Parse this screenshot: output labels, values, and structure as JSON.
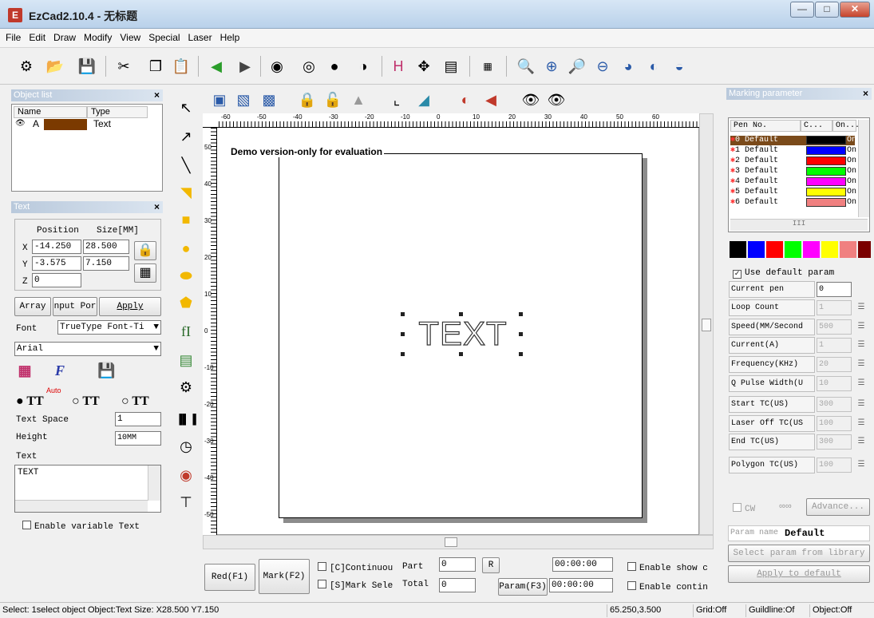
{
  "window": {
    "title": "EzCad2.10.4 - 无标题",
    "logo_text": "E"
  },
  "menu": [
    "File",
    "Edit",
    "Draw",
    "Modify",
    "View",
    "Special",
    "Laser",
    "Help"
  ],
  "toolbar_icons": [
    "gear-icon",
    "folder-open-icon",
    "save-icon",
    "cut-icon",
    "copy-icon",
    "paste-icon",
    "back-icon",
    "forward-icon",
    "node-select-icon",
    "node-add-icon",
    "node-delete-icon",
    "node-break-icon",
    "hatch-icon",
    "tools-icon",
    "properties-icon",
    "pen-table-icon",
    "zoom-icon",
    "zoom-in-icon",
    "zoom-plus-icon",
    "zoom-out-icon",
    "zoom-fit-icon",
    "zoom-all-icon",
    "zoom-objects-icon"
  ],
  "object_list": {
    "title": "Object list",
    "headers": [
      "Name",
      "Type"
    ],
    "rows": [
      {
        "name": "A",
        "type": "Text",
        "color": "#7b3a00"
      }
    ]
  },
  "text_panel": {
    "title": "Text",
    "position_label": "Position",
    "size_label": "Size[MM]",
    "x_label": "X",
    "x": "-14.250",
    "w": "28.500",
    "y_label": "Y",
    "y": "-3.575",
    "h": "7.150",
    "z_label": "Z",
    "z": "0",
    "array_btn": "Array",
    "input_btn": "nput Por",
    "apply_btn": "Apply",
    "font_label": "Font",
    "font_type": "TrueType Font-Ti",
    "font_name": "Arial",
    "auto_label": "Auto",
    "text_space_label": "Text Space",
    "text_space": "1",
    "height_label": "Height",
    "height": "10MM",
    "text_label": "Text",
    "text_value": "TEXT",
    "variable_label": "Enable variable Text"
  },
  "canvas": {
    "demo_label": "Demo version-only for evaluation",
    "text_object": "TEXT",
    "hruler_labels": [
      "-60",
      "-50",
      "-40",
      "-30",
      "-20",
      "-10",
      "0",
      "10",
      "20",
      "30",
      "40",
      "50",
      "60"
    ],
    "vruler_labels": [
      "50",
      "40",
      "30",
      "20",
      "10",
      "0",
      "-10",
      "-20",
      "-30",
      "-40",
      "-50"
    ]
  },
  "marking": {
    "title": "Marking parameter",
    "headers": [
      "Pen No.",
      "C...",
      "On..."
    ],
    "pens": [
      {
        "label": "0 Default",
        "color": "#000000",
        "on": "On"
      },
      {
        "label": "1 Default",
        "color": "#0000ff",
        "on": "On"
      },
      {
        "label": "2 Default",
        "color": "#ff0000",
        "on": "On"
      },
      {
        "label": "3 Default",
        "color": "#00ff00",
        "on": "On"
      },
      {
        "label": "4 Default",
        "color": "#ff00ff",
        "on": "On"
      },
      {
        "label": "5 Default",
        "color": "#ffff00",
        "on": "On"
      },
      {
        "label": "6 Default",
        "color": "#f08080",
        "on": "On"
      }
    ],
    "scroll_label": "III",
    "palette": [
      "#000000",
      "#0000ff",
      "#ff0000",
      "#00ff00",
      "#ff00ff",
      "#ffff00",
      "#f08080",
      "#7a0000"
    ],
    "use_default": "Use default param",
    "current_pen_label": "Current pen",
    "current_pen": "0",
    "params": [
      {
        "label": "Loop Count",
        "value": "1"
      },
      {
        "label": "Speed(MM/Second",
        "value": "500"
      },
      {
        "label": "Current(A)",
        "value": "1"
      },
      {
        "label": "Frequency(KHz)",
        "value": "20"
      },
      {
        "label": "Q Pulse Width(U",
        "value": "10"
      },
      {
        "label": "Start TC(US)",
        "value": "300"
      },
      {
        "label": "Laser Off TC(US",
        "value": "100"
      },
      {
        "label": "End TC(US)",
        "value": "300"
      },
      {
        "label": "Polygon TC(US)",
        "value": "100"
      }
    ],
    "cw_label": "CW",
    "advance_btn": "Advance...",
    "param_name_label": "Param name",
    "param_name": "Default",
    "select_library_btn": "Select param from library",
    "apply_default_btn": "Apply to default"
  },
  "bottom": {
    "red_btn": "Red(F1)",
    "mark_btn": "Mark(F2)",
    "continuous_label": "[C]Continuou",
    "mark_select_label": "[S]Mark Sele",
    "part_label": "Part",
    "part_value": "0",
    "total_label": "Total",
    "total_value": "0",
    "r_btn": "R",
    "param_btn": "Param(F3)",
    "time1": "00:00:00",
    "time2": "00:00:00",
    "enable_show": "Enable show c",
    "enable_contin": "Enable contin"
  },
  "status": {
    "message": "Select: 1select object Object:Text Size: X28.500 Y7.150",
    "coords": "65.250,3.500",
    "grid": "Grid:Off",
    "guideline": "Guildline:Of",
    "object": "Object:Off"
  }
}
